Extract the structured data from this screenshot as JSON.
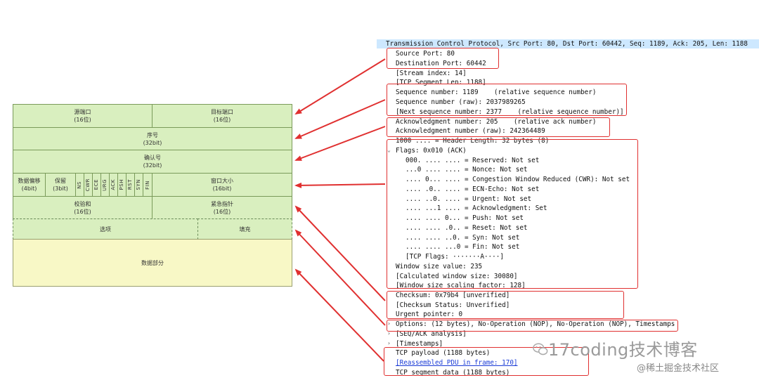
{
  "diagram": {
    "row1": {
      "left_name": "源端口",
      "left_bits": "(16位)",
      "right_name": "目标端口",
      "right_bits": "(16位)"
    },
    "row2": {
      "name": "序号",
      "bits": "(32bit)"
    },
    "row3": {
      "name": "确认号",
      "bits": "(32bit)"
    },
    "row4": {
      "offset_name": "数据偏移",
      "offset_bits": "(4bit)",
      "reserved_name": "保留",
      "reserved_bits": "(3bit)",
      "flags": [
        "NS",
        "CWR",
        "ECE",
        "URG",
        "ACK",
        "PSH",
        "RST",
        "SYN",
        "FIN"
      ],
      "window_name": "窗口大小",
      "window_bits": "(16bit)"
    },
    "row5": {
      "left_name": "校验和",
      "left_bits": "(16位)",
      "right_name": "紧急指针",
      "right_bits": "(16位)"
    },
    "row6": {
      "left_name": "选项",
      "right_name": "填充"
    },
    "row7": {
      "name": "数据部分"
    }
  },
  "tree": {
    "header": "Transmission Control Protocol, Src Port: 80, Dst Port: 60442, Seq: 1189, Ack: 205, Len: 1188",
    "lines": [
      "Source Port: 80",
      "Destination Port: 60442",
      "[Stream index: 14]",
      "[TCP Segment Len: 1188]",
      "Sequence number: 1189    (relative sequence number)",
      "Sequence number (raw): 2037989265",
      "[Next sequence number: 2377    (relative sequence number)]",
      "Acknowledgment number: 205    (relative ack number)",
      "Acknowledgment number (raw): 242364489",
      "1000 .... = Header Length: 32 bytes (8)",
      "Flags: 0x010 (ACK)",
      "000. .... .... = Reserved: Not set",
      "...0 .... .... = Nonce: Not set",
      ".... 0... .... = Congestion Window Reduced (CWR): Not set",
      ".... .0.. .... = ECN-Echo: Not set",
      ".... ..0. .... = Urgent: Not set",
      ".... ...1 .... = Acknowledgment: Set",
      ".... .... 0... = Push: Not set",
      ".... .... .0.. = Reset: Not set",
      ".... .... ..0. = Syn: Not set",
      ".... .... ...0 = Fin: Not set",
      "[TCP Flags: ·······A····]",
      "Window size value: 235",
      "[Calculated window size: 30080]",
      "[Window size scaling factor: 128]",
      "Checksum: 0x79b4 [unverified]",
      "[Checksum Status: Unverified]",
      "Urgent pointer: 0",
      "Options: (12 bytes), No-Operation (NOP), No-Operation (NOP), Timestamps",
      "[SEQ/ACK analysis]",
      "[Timestamps]",
      "TCP payload (1188 bytes)",
      "[Reassembled PDU in frame: 170]",
      "TCP segment data (1188 bytes)"
    ]
  },
  "watermark": {
    "text": "17coding技术博客",
    "footer": "@稀土掘金技术社区"
  },
  "colors": {
    "accent_red": "#e03030",
    "header_green": "#d9efbf",
    "data_yellow": "#f8f8c6",
    "selected_blue": "#cde8ff",
    "link_blue": "#1a3bd6"
  }
}
